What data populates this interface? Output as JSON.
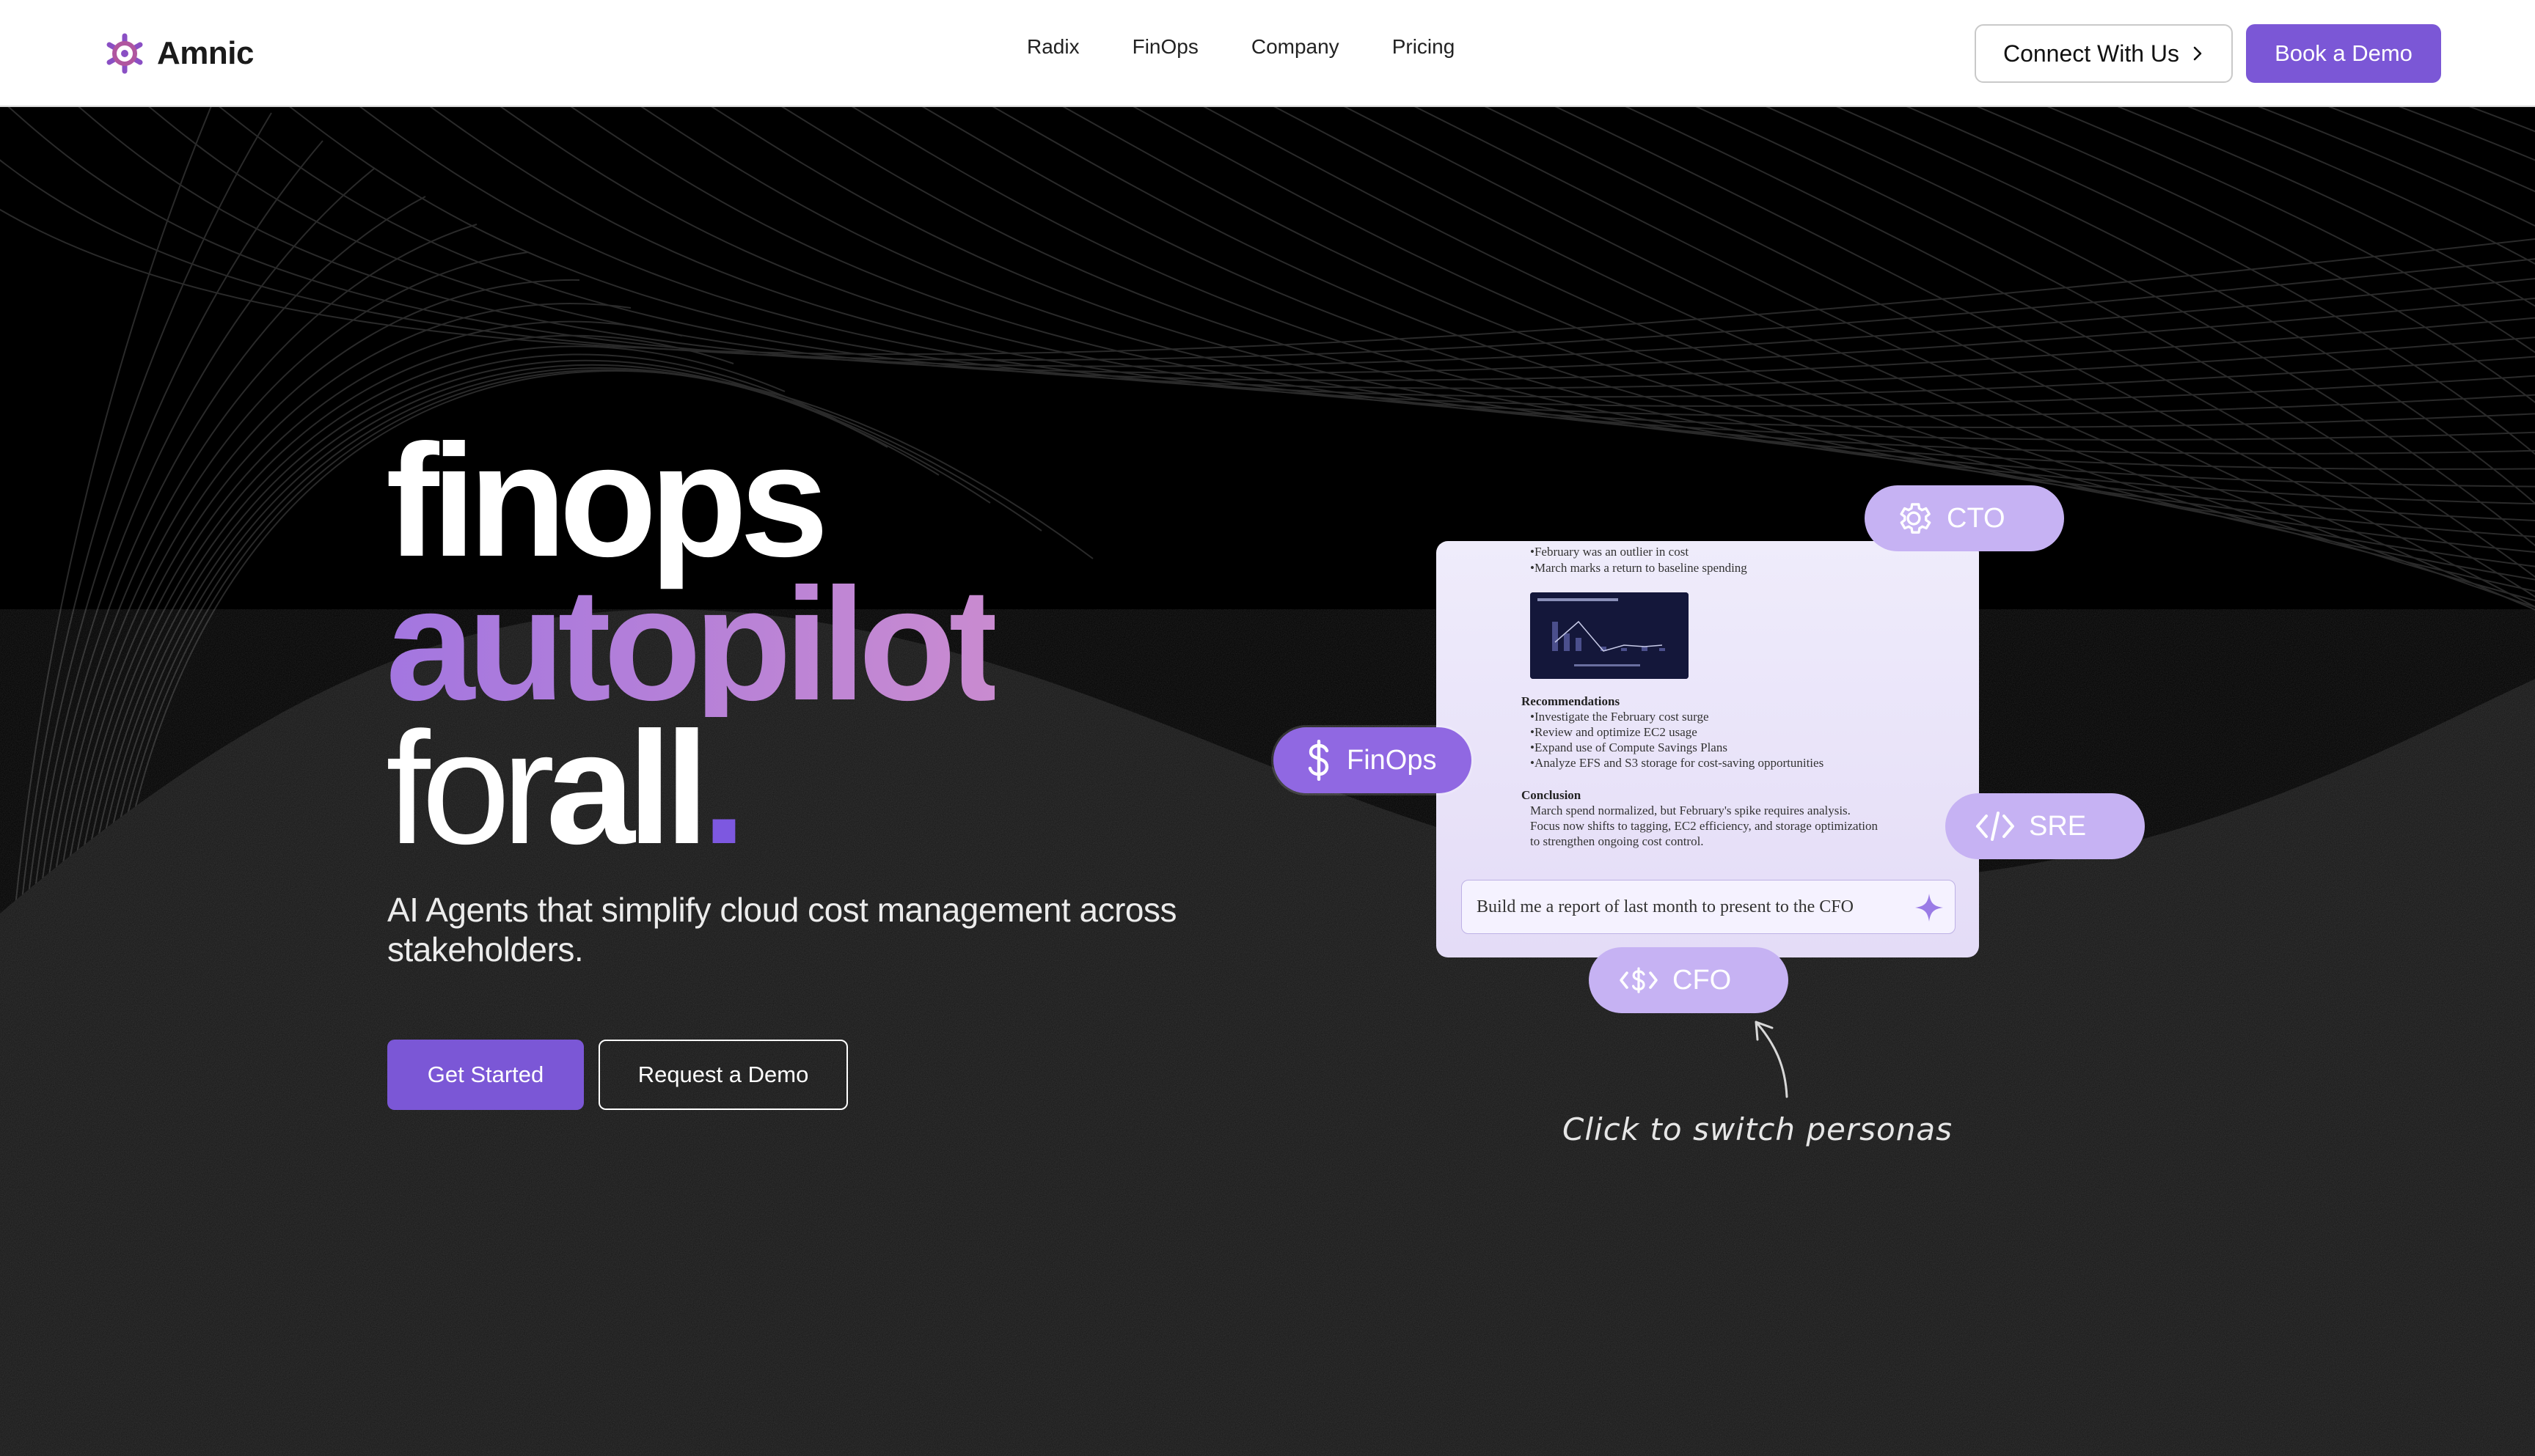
{
  "nav": {
    "brand": "Amnic",
    "links": [
      "Radix",
      "FinOps",
      "Company",
      "Pricing"
    ],
    "connect_label": "Connect With Us",
    "demo_label": "Book a Demo"
  },
  "hero": {
    "line1": "finops",
    "line2": "autopilot",
    "line3_thin": "for",
    "line3_bold": "all",
    "line3_dot": ".",
    "subhead": "AI Agents that simplify cloud cost management across stakeholders.",
    "cta_primary": "Get Started",
    "cta_secondary": "Request a Demo"
  },
  "card": {
    "bullets": [
      "•February was an outlier in cost",
      "•March marks a return to baseline spending"
    ],
    "recommendations_title": "Recommendations",
    "recommendations": [
      "•Investigate the February cost surge",
      "•Review and optimize EC2 usage",
      "•Expand use of Compute Savings Plans",
      "•Analyze EFS and S3 storage for cost-saving opportunities"
    ],
    "conclusion_title": "Conclusion",
    "conclusion": [
      "March spend normalized, but February's spike requires analysis.",
      "Focus now shifts to tagging, EC2 efficiency, and storage optimization",
      "to strengthen ongoing cost control."
    ],
    "prompt": "Build me a report of last month to present to the CFO"
  },
  "personas": {
    "cto": "CTO",
    "finops": "FinOps",
    "sre": "SRE",
    "cfo": "CFO"
  },
  "hint": "Click to switch personas",
  "colors": {
    "accent": "#7b57d6",
    "pill_light": "#c6b2f3",
    "pill_strong": "#9068e2",
    "background": "#0b0b0c"
  }
}
